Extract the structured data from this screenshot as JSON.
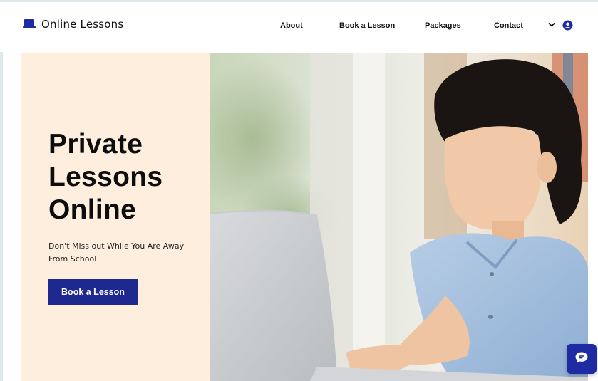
{
  "brand": {
    "name": "Online Lessons",
    "logo_icon": "laptop-icon"
  },
  "nav": {
    "items": [
      {
        "label": "About"
      },
      {
        "label": "Book a Lesson"
      },
      {
        "label": "Packages"
      },
      {
        "label": "Contact"
      }
    ],
    "more_icon": "chevron-down-icon",
    "account_icon": "user-account-icon"
  },
  "hero": {
    "title_lines": [
      "Private",
      "Lessons",
      "Online"
    ],
    "subtitle": "Don't Miss out While You Are Away From School",
    "cta_label": "Book a Lesson"
  },
  "chat": {
    "icon": "chat-bubble-icon"
  },
  "colors": {
    "accent": "#1f2ba3",
    "button": "#1e2990",
    "hero_panel": "#fdeedd",
    "text": "#111111"
  }
}
